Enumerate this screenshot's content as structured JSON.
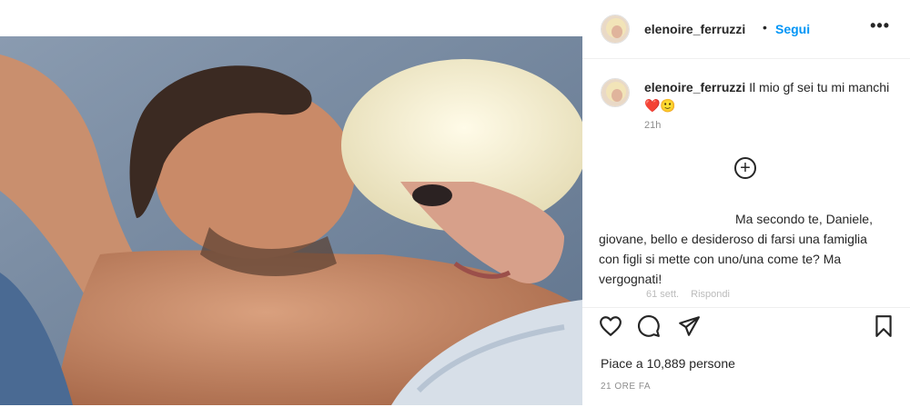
{
  "post": {
    "username": "elenoire_ferruzzi",
    "follow_label": "Segui",
    "separator": "•",
    "more_label": "•••"
  },
  "caption": {
    "username": "elenoire_ferruzzi",
    "text": " Il mio gf sei tu mi manchi❤️🙂",
    "time": "21h"
  },
  "load_more_label": "+",
  "comment": {
    "text": "Ma secondo te, Daniele, giovane, bello e desideroso di farsi una famiglia con figli si mette con uno/una come te? Ma vergognati!",
    "time": "61 sett.",
    "reply_label": "Rispondi"
  },
  "likes": {
    "text": "Piace a 10,889 persone"
  },
  "date": "21 ORE FA",
  "icons": {
    "like": "heart-icon",
    "comment": "comment-icon",
    "share": "paper-plane-icon",
    "save": "bookmark-icon",
    "more": "more-dots-icon",
    "add": "plus-circle-icon"
  }
}
